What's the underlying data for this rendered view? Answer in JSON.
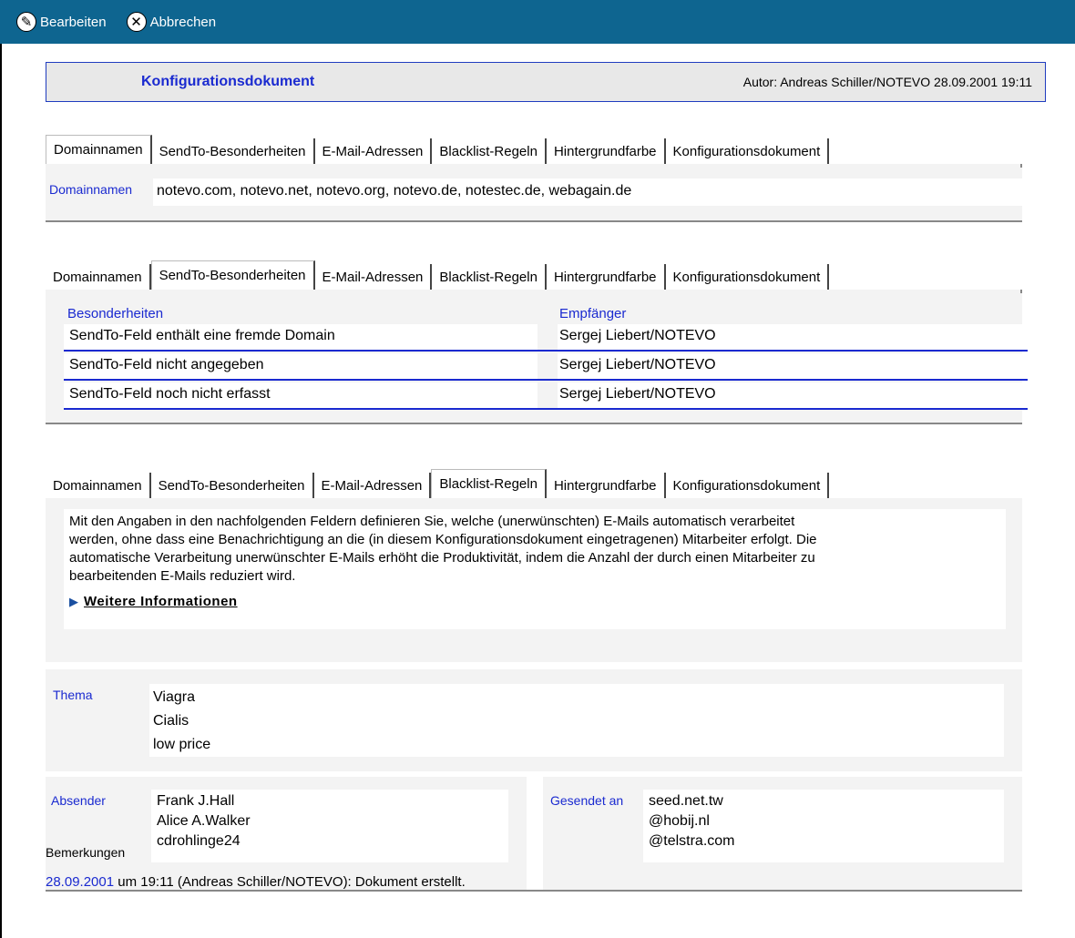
{
  "toolbar": {
    "edit_label": "Bearbeiten",
    "cancel_label": "Abbrechen"
  },
  "header": {
    "title": "Konfigurationsdokument",
    "author": "Autor: Andreas Schiller/NOTEVO 28.09.2001 19:11"
  },
  "tabs": [
    "Domainnamen",
    "SendTo-Besonderheiten",
    "E-Mail-Adressen",
    "Blacklist-Regeln",
    "Hintergrundfarbe",
    "Konfigurationsdokument"
  ],
  "domains": {
    "label": "Domainnamen",
    "value": "notevo.com, notevo.net, notevo.org, notevo.de, notestec.de, webagain.de"
  },
  "sendto": {
    "col1_header": "Besonderheiten",
    "col2_header": "Empfänger",
    "rows": [
      {
        "case": "SendTo-Feld enthält eine fremde Domain",
        "recipient": "Sergej Liebert/NOTEVO"
      },
      {
        "case": "SendTo-Feld nicht angegeben",
        "recipient": "Sergej Liebert/NOTEVO"
      },
      {
        "case": "SendTo-Feld noch nicht erfasst",
        "recipient": "Sergej Liebert/NOTEVO"
      }
    ]
  },
  "blacklist": {
    "info_lines": [
      "Mit den Angaben in den nachfolgenden Feldern definieren Sie, welche (unerwünschten) E-Mails automatisch verarbeitet",
      "werden, ohne dass eine Benachrichtigung an die (in diesem Konfigurationsdokument eingetragenen) Mitarbeiter erfolgt. Die",
      "automatische Verarbeitung unerwünschter E-Mails erhöht die Produktivität, indem die Anzahl der durch einen Mitarbeiter zu",
      "bearbeitenden E-Mails reduziert wird."
    ],
    "more_label": "Weitere Informationen",
    "thema_label": "Thema",
    "thema_values": [
      "Viagra",
      "Cialis",
      "low price"
    ],
    "absender_label": "Absender",
    "absender_values": [
      "Frank J.Hall",
      "Alice A.Walker",
      "cdrohlinge24"
    ],
    "gesendet_label": "Gesendet an",
    "gesendet_values": [
      "seed.net.tw",
      "@hobij.nl",
      "@telstra.com"
    ]
  },
  "remarks": {
    "label": "Bemerkungen",
    "date": "28.09.2001",
    "text": " um 19:11 (Andreas Schiller/NOTEVO): Dokument erstellt."
  },
  "colors": {
    "toolbar_bg": "#0e6590",
    "accent_blue": "#1a2ad0"
  }
}
